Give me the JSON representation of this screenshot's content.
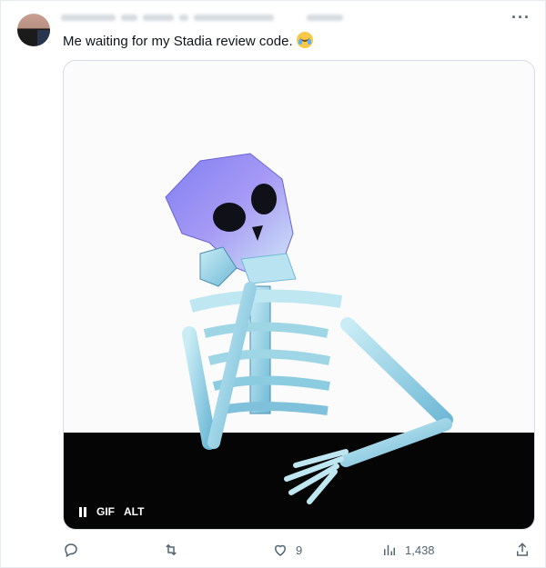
{
  "tweet": {
    "text": "Me waiting for my Stadia review code.",
    "emoji": "joy-tears-emoji"
  },
  "media": {
    "controls": {
      "gif_label": "GIF",
      "alt_label": "ALT",
      "pause_icon": "pause-icon"
    },
    "colors": {
      "floor": "#050505",
      "background": "#fbfbfc",
      "bone": "#9fd6e6",
      "skull": "#8c7ff0"
    }
  },
  "actions": {
    "reply": {
      "icon": "reply-icon",
      "count": ""
    },
    "retweet": {
      "icon": "retweet-icon",
      "count": ""
    },
    "like": {
      "icon": "heart-icon",
      "count": "9"
    },
    "views": {
      "icon": "views-icon",
      "count": "1,438"
    },
    "share": {
      "icon": "share-icon"
    }
  },
  "more_menu": {
    "icon": "more-icon",
    "label": "···"
  },
  "colors": {
    "secondary_text": "#536471",
    "border": "#d7dde2"
  }
}
